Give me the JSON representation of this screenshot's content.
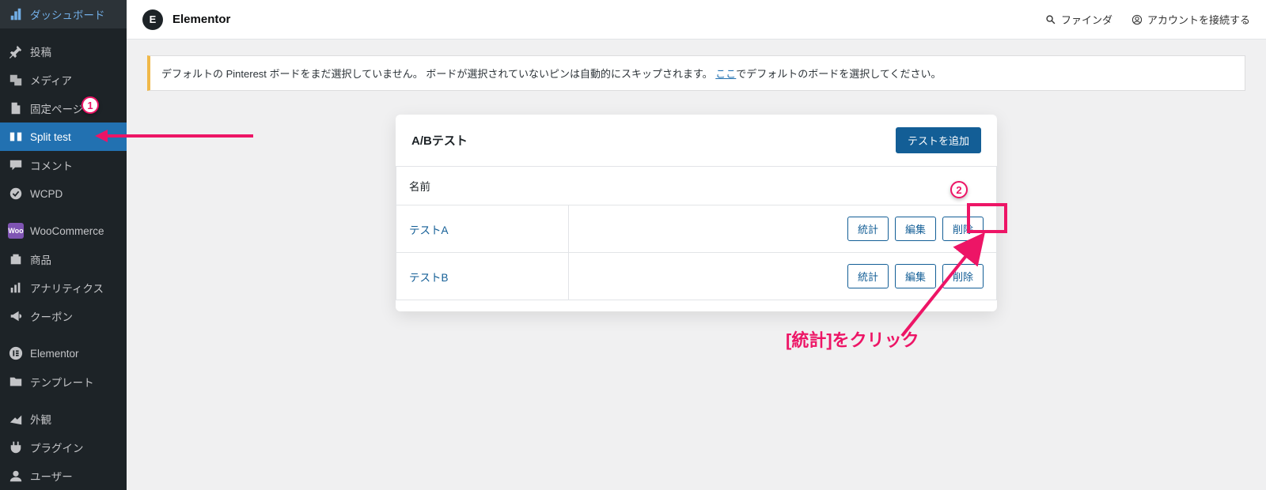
{
  "sidebar": {
    "items": [
      {
        "label": "ダッシュボード",
        "icon": "dashboard"
      },
      {
        "label": "投稿",
        "icon": "pin"
      },
      {
        "label": "メディア",
        "icon": "media"
      },
      {
        "label": "固定ページ",
        "icon": "page"
      },
      {
        "label": "Split test",
        "icon": "split",
        "current": true
      },
      {
        "label": "コメント",
        "icon": "comment"
      },
      {
        "label": "WCPD",
        "icon": "check"
      },
      {
        "label": "WooCommerce",
        "icon": "woo"
      },
      {
        "label": "商品",
        "icon": "product"
      },
      {
        "label": "アナリティクス",
        "icon": "chart"
      },
      {
        "label": "クーポン",
        "icon": "megaphone"
      },
      {
        "label": "Elementor",
        "icon": "elementor"
      },
      {
        "label": "テンプレート",
        "icon": "folder"
      },
      {
        "label": "外観",
        "icon": "appearance"
      },
      {
        "label": "プラグイン",
        "icon": "plugin"
      },
      {
        "label": "ユーザー",
        "icon": "user"
      }
    ]
  },
  "topbar": {
    "title": "Elementor",
    "logo": "E",
    "finder": "ファインダ",
    "connect": "アカウントを接続する"
  },
  "notice": {
    "text1": "デフォルトの Pinterest ボードをまだ選択していません。 ボードが選択されていないピンは自動的にスキップされます。 ",
    "link": "ここ",
    "text2": "でデフォルトのボードを選択してください。"
  },
  "card": {
    "title": "A/Bテスト",
    "add_btn": "テストを追加",
    "col_name": "名前",
    "rows": [
      {
        "name": "テストA"
      },
      {
        "name": "テストB"
      }
    ],
    "btn_stats": "統計",
    "btn_edit": "編集",
    "btn_delete": "削除"
  },
  "annotations": {
    "badge1": "1",
    "badge2": "2",
    "text1": "[統計]をクリック"
  }
}
